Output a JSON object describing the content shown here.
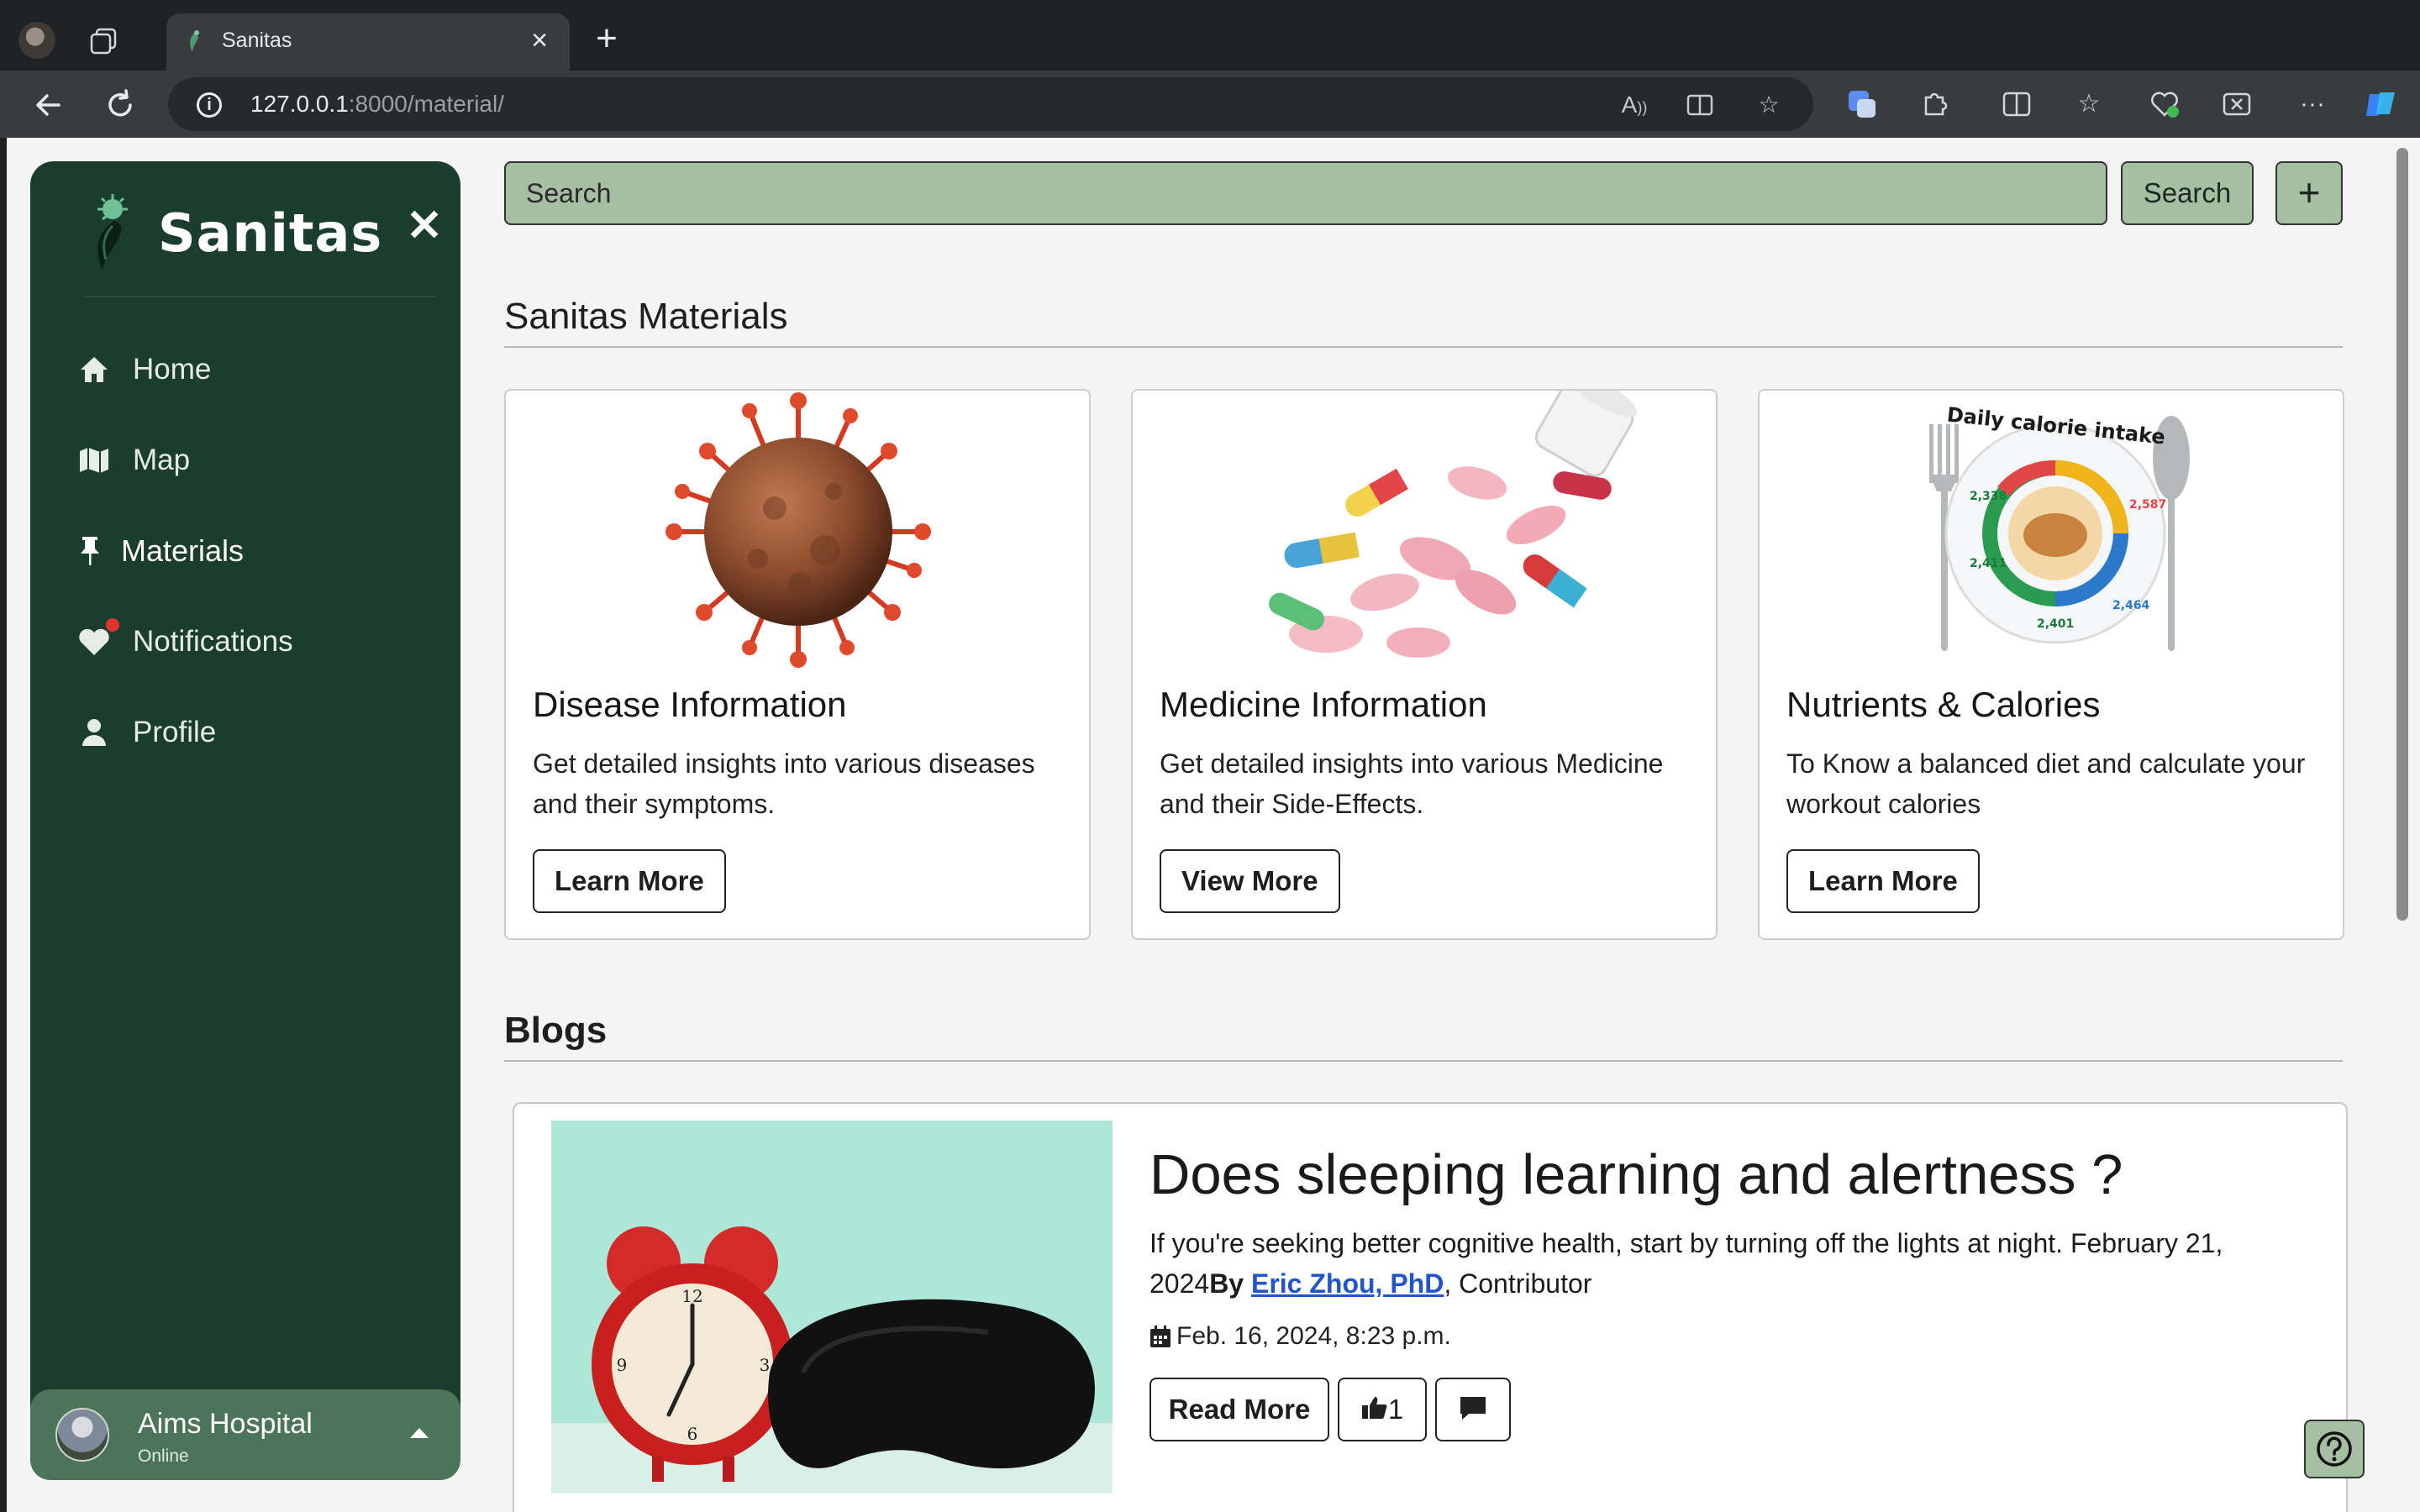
{
  "browser": {
    "tab_title": "Sanitas",
    "url_host": "127.0.0.1",
    "url_path": ":8000/material/"
  },
  "sidebar": {
    "brand": "Sanitas",
    "items": [
      {
        "label": "Home",
        "icon": "home-icon"
      },
      {
        "label": "Map",
        "icon": "map-icon"
      },
      {
        "label": "Materials",
        "icon": "pin-icon",
        "active": true
      },
      {
        "label": "Notifications",
        "icon": "heart-icon"
      },
      {
        "label": "Profile",
        "icon": "person-icon"
      }
    ],
    "user": {
      "name": "Aims Hospital",
      "status": "Online"
    }
  },
  "search": {
    "placeholder": "Search",
    "button": "Search",
    "add": "+"
  },
  "materials": {
    "title": "Sanitas Materials",
    "cards": [
      {
        "title": "Disease Information",
        "text": "Get detailed insights into various diseases and their symptoms.",
        "button": "Learn More"
      },
      {
        "title": "Medicine Information",
        "text": "Get detailed insights into various Medicine and their Side-Effects.",
        "button": "View More"
      },
      {
        "title": "Nutrients & Calories",
        "text": "To Know a balanced diet and calculate your workout calories",
        "button": "Learn More",
        "image_text": "Daily calorie intake"
      }
    ]
  },
  "blogs": {
    "title": "Blogs",
    "post": {
      "title": "Does sleeping learning and alertness ?",
      "excerpt": "If you're seeking better cognitive health, start by turning off the lights at night. February 21, 2024",
      "by": "By",
      "author": "Eric Zhou, PhD",
      "role": ", Contributor",
      "date": "Feb. 16, 2024, 8:23 p.m.",
      "read_more": "Read More",
      "likes": "1"
    }
  },
  "colors": {
    "sidebar": "#1b3d2d",
    "accent": "#a6bfa2",
    "user_card": "#4b7459"
  }
}
